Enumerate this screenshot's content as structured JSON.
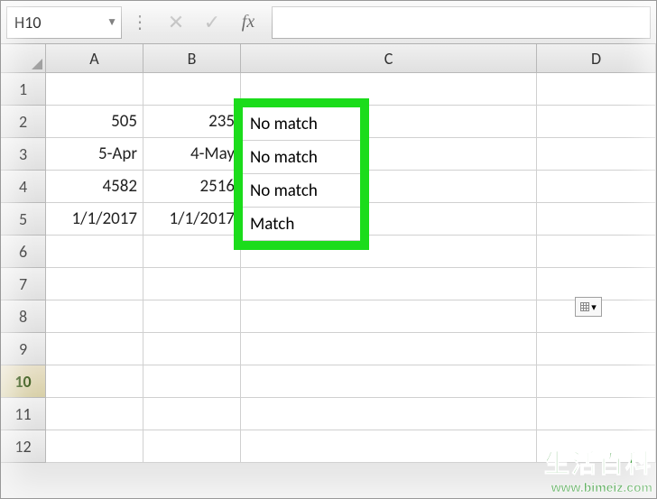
{
  "name_box": "H10",
  "formula_bar_value": "",
  "columns": [
    "A",
    "B",
    "C",
    "D"
  ],
  "rows": [
    "1",
    "2",
    "3",
    "4",
    "5",
    "6",
    "7",
    "8",
    "9",
    "10",
    "11",
    "12"
  ],
  "active_row": "10",
  "cells": {
    "A2": "505",
    "B2": "235",
    "C2": "No match",
    "A3": "5-Apr",
    "B3": "4-May",
    "C3": "No match",
    "A4": "4582",
    "B4": "2516",
    "C4": "No match",
    "A5": "1/1/2017",
    "B5": "1/1/2017",
    "C5": "Match"
  },
  "autofill_symbol": "▾",
  "watermark": {
    "title": "生活百科",
    "url": "www.bimeiz.com"
  }
}
